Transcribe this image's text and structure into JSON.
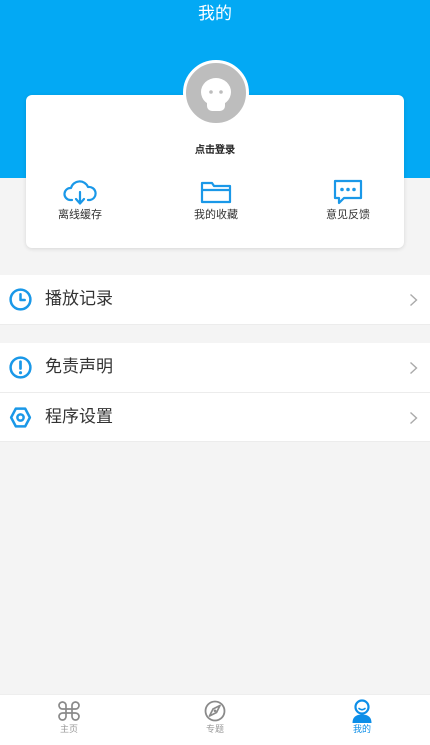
{
  "header": {
    "title": "我的"
  },
  "profile": {
    "login_label": "点击登录"
  },
  "shortcuts": [
    {
      "label": "离线缓存",
      "icon": "cloud-download-icon"
    },
    {
      "label": "我的收藏",
      "icon": "folder-icon"
    },
    {
      "label": "意见反馈",
      "icon": "chat-bubble-icon"
    }
  ],
  "menu": {
    "history": {
      "label": "播放记录",
      "icon": "clock-icon"
    },
    "disclaimer": {
      "label": "免责声明",
      "icon": "exclamation-icon"
    },
    "settings": {
      "label": "程序设置",
      "icon": "settings-icon"
    }
  },
  "tabbar": [
    {
      "label": "主页",
      "icon": "command-key-icon",
      "active": false
    },
    {
      "label": "专题",
      "icon": "compass-icon",
      "active": false
    },
    {
      "label": "我的",
      "icon": "person-icon",
      "active": true
    }
  ],
  "colors": {
    "accent": "#03a9f4",
    "icon_blue": "#1a98e8",
    "inactive": "#999999",
    "background": "#f4f4f4"
  }
}
